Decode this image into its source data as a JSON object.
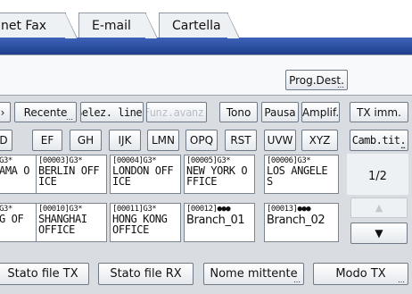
{
  "tabs": [
    {
      "label": "net Fax"
    },
    {
      "label": "E-mail"
    },
    {
      "label": "Cartella"
    }
  ],
  "prog_dest_label": "Prog.Dest.",
  "toolbar": {
    "recente": "Recente",
    "selez_linea": "Selez. linea",
    "funz_avanz": "Funz.avanz.",
    "tono": "Tono",
    "pausa": "Pausa",
    "amplif": "Amplif.",
    "tx_imm": "TX imm."
  },
  "index_tabs": [
    "D",
    "EF",
    "GH",
    "IJK",
    "LMN",
    "OPQ",
    "RST",
    "UVW",
    "XYZ"
  ],
  "camb_tit": "Camb.tit.",
  "destinations_row1": [
    {
      "header": "G3*",
      "name1": "AMA O",
      "name2": ""
    },
    {
      "header": "[00003]G3*",
      "name1": "BERLIN OFF",
      "name2": "ICE"
    },
    {
      "header": "[00004]G3*",
      "name1": "LONDON OFF",
      "name2": "ICE"
    },
    {
      "header": "[00005]G3*",
      "name1": "NEW YORK O",
      "name2": "FFICE"
    },
    {
      "header": "[00006]G3*",
      "name1": "LOS ANGELE",
      "name2": "S"
    }
  ],
  "destinations_row2": [
    {
      "header": "G3*",
      "name1": "G OF",
      "name2": ""
    },
    {
      "header": "[00010]G3*",
      "name1": "SHANGHAI",
      "name2": "OFFICE"
    },
    {
      "header": "[00011]G3*",
      "name1": "HONG KONG",
      "name2": "OFFICE"
    },
    {
      "header": "[00012]",
      "name1": "Branch_01",
      "name2": ""
    },
    {
      "header": "[00013]",
      "name1": "Branch_02",
      "name2": ""
    }
  ],
  "page_indicator": "1/2",
  "footer": {
    "stato_tx": "Stato file TX",
    "stato_rx": "Stato file RX",
    "nome_mittente": "Nome mittente",
    "modo_tx": "Modo TX"
  },
  "colors": {
    "band": "#1f3f8c",
    "background": "#d9dde2"
  }
}
